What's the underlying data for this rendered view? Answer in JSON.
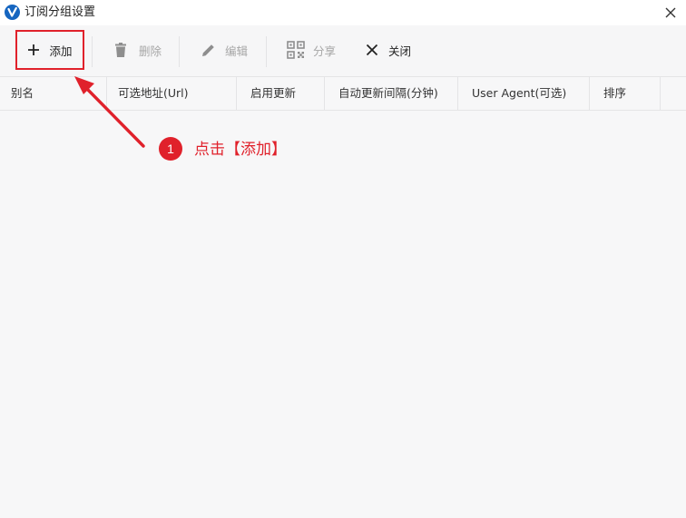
{
  "window": {
    "title": "订阅分组设置"
  },
  "toolbar": {
    "add_label": "添加",
    "delete_label": "删除",
    "edit_label": "编辑",
    "share_label": "分享",
    "close_label": "关闭"
  },
  "table": {
    "columns": [
      "别名",
      "可选地址(Url)",
      "启用更新",
      "自动更新间隔(分钟)",
      "User Agent(可选)",
      "排序"
    ],
    "rows": []
  },
  "annotation": {
    "step_number": "1",
    "step_text": "点击【添加】"
  },
  "colors": {
    "accent_red": "#e0212b",
    "app_icon_blue": "#1e88e5",
    "disabled_text": "#a6a6a6"
  },
  "icons": {
    "app": "app-logo-icon",
    "close": "close-icon",
    "add": "plus-icon",
    "delete": "trash-icon",
    "edit": "pencil-icon",
    "share": "qrcode-icon",
    "close_button": "x-icon"
  }
}
